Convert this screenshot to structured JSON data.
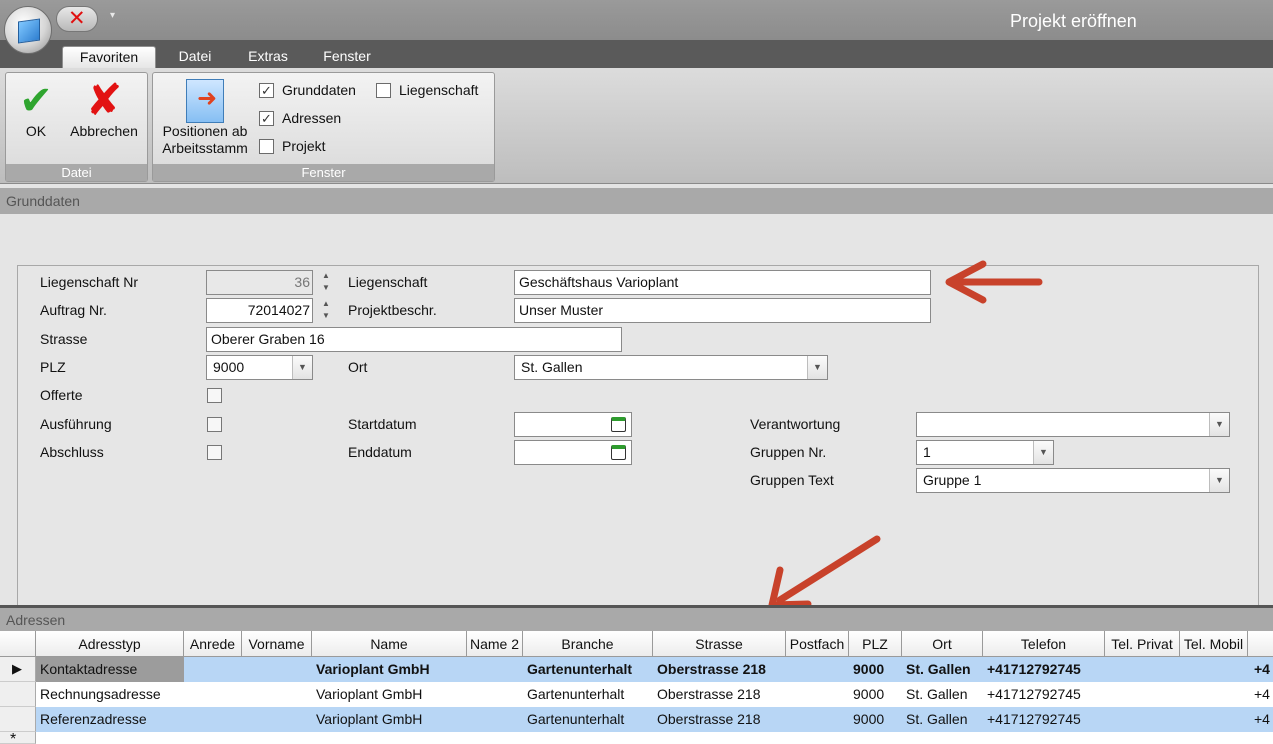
{
  "window": {
    "title": "Projekt eröffnen"
  },
  "quick_access": {
    "close_icon": "x-icon",
    "dropdown": "▾"
  },
  "tabs": [
    {
      "label": "Favoriten",
      "active": true
    },
    {
      "label": "Datei",
      "active": false
    },
    {
      "label": "Extras",
      "active": false
    },
    {
      "label": "Fenster",
      "active": false
    }
  ],
  "ribbon": {
    "datei_group": {
      "label": "Datei",
      "ok": "OK",
      "cancel": "Abbrechen"
    },
    "fenster_group": {
      "label": "Fenster",
      "positions_line1": "Positionen ab",
      "positions_line2": "Arbeitsstamm",
      "chk_grunddaten": "Grunddaten",
      "chk_adressen": "Adressen",
      "chk_projekt": "Projekt",
      "chk_liegenschaft": "Liegenschaft"
    }
  },
  "grunddaten": {
    "section_title": "Grunddaten",
    "labels": {
      "liegenschaft_nr": "Liegenschaft Nr",
      "auftrag_nr": "Auftrag Nr.",
      "strasse": "Strasse",
      "plz": "PLZ",
      "offerte": "Offerte",
      "ausfuehrung": "Ausführung",
      "abschluss": "Abschluss",
      "liegenschaft": "Liegenschaft",
      "projektbeschr": "Projektbeschr.",
      "ort": "Ort",
      "startdatum": "Startdatum",
      "enddatum": "Enddatum",
      "verantwortung": "Verantwortung",
      "gruppen_nr": "Gruppen Nr.",
      "gruppen_text": "Gruppen Text"
    },
    "values": {
      "liegenschaft_nr": "36",
      "auftrag_nr": "72014027",
      "strasse": "Oberer Graben 16",
      "plz": "9000",
      "liegenschaft": "Geschäftshaus Varioplant",
      "projektbeschr": "Unser Muster",
      "ort": "St. Gallen",
      "startdatum": "",
      "enddatum": "",
      "verantwortung": "",
      "gruppen_nr": "1",
      "gruppen_text": "Gruppe 1"
    }
  },
  "adressen": {
    "section_title": "Adressen",
    "columns": [
      "Adresstyp",
      "Anrede",
      "Vorname",
      "Name",
      "Name 2",
      "Branche",
      "Strasse",
      "Postfach",
      "PLZ",
      "Ort",
      "Telefon",
      "Tel. Privat",
      "Tel. Mobil"
    ],
    "rows": [
      {
        "adresstyp": "Kontaktadresse",
        "anrede": "",
        "vorname": "",
        "name": "Varioplant GmbH",
        "name2": "",
        "branche": "Gartenunterhalt",
        "strasse": "Oberstrasse 218",
        "postfach": "",
        "plz": "9000",
        "ort": "St. Gallen",
        "telefon": "+41712792745",
        "tel_privat": "",
        "tel_mobil": "",
        "extra": "+4"
      },
      {
        "adresstyp": "Rechnungsadresse",
        "anrede": "",
        "vorname": "",
        "name": "Varioplant GmbH",
        "name2": "",
        "branche": "Gartenunterhalt",
        "strasse": "Oberstrasse 218",
        "postfach": "",
        "plz": "9000",
        "ort": "St. Gallen",
        "telefon": "+41712792745",
        "tel_privat": "",
        "tel_mobil": "",
        "extra": "+4"
      },
      {
        "adresstyp": "Referenzadresse",
        "anrede": "",
        "vorname": "",
        "name": "Varioplant GmbH",
        "name2": "",
        "branche": "Gartenunterhalt",
        "strasse": "Oberstrasse 218",
        "postfach": "",
        "plz": "9000",
        "ort": "St. Gallen",
        "telefon": "+41712792745",
        "tel_privat": "",
        "tel_mobil": "",
        "extra": "+4"
      }
    ],
    "new_row_marker": "*"
  },
  "colors": {
    "selection": "#b8d6f5",
    "arrow": "#c8422b"
  }
}
